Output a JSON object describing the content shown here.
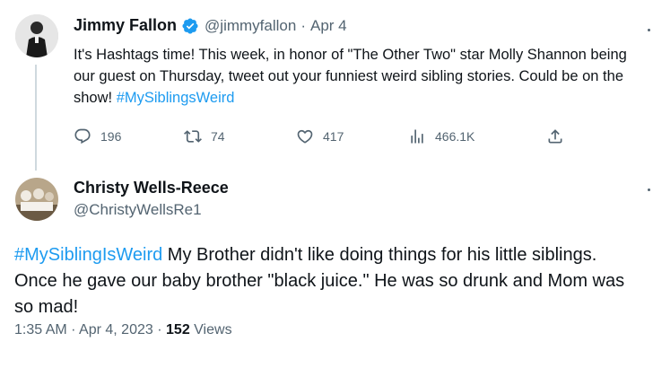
{
  "tweet1": {
    "name": "Jimmy Fallon",
    "handle": "@jimmyfallon",
    "separator": "·",
    "date": "Apr 4",
    "text_before": "It's Hashtags time! This week, in honor of \"The Other Two\" star Molly Shannon being our guest on Thursday, tweet out your funniest weird sibling stories. Could be on the show! ",
    "hashtag": "#MySiblingsWeird",
    "replies": "196",
    "retweets": "74",
    "likes": "417",
    "views": "466.1K"
  },
  "tweet2": {
    "name": "Christy Wells-Reece",
    "handle": "@ChristyWellsRe1",
    "hashtag": "#MySiblingIsWeird",
    "text_after": " My Brother didn't like doing things for his little siblings. Once he gave our baby brother \"black juice.\" He was so drunk and Mom was so mad!",
    "time": "1:35 AM",
    "separator": "·",
    "date": "Apr 4, 2023",
    "separator2": "·",
    "views_count": "152",
    "views_label": "Views"
  },
  "colors": {
    "accent": "#1d9bf0",
    "muted": "#536471",
    "text": "#0f1419",
    "verified": "#1d9bf0"
  },
  "icons": [
    "verified-badge-icon",
    "reply-icon",
    "retweet-icon",
    "like-icon",
    "views-icon",
    "share-icon",
    "more-icon"
  ]
}
